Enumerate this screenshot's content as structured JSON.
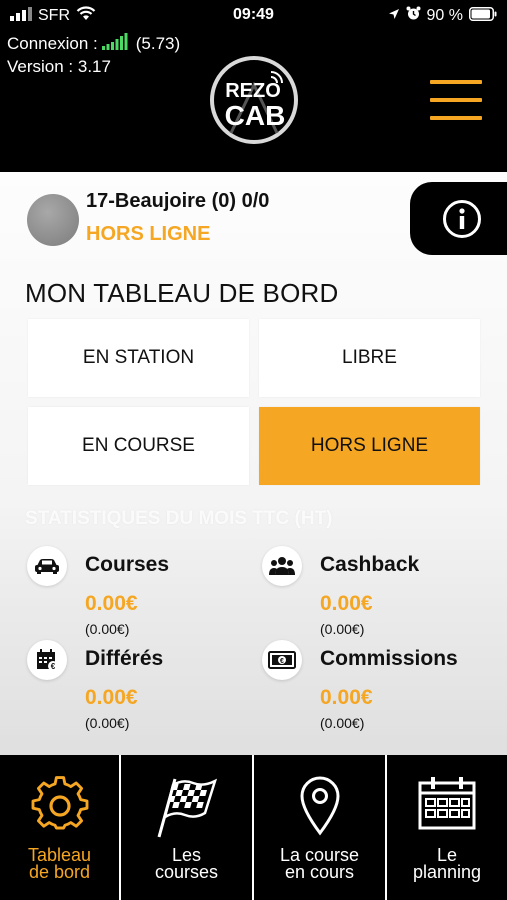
{
  "status_bar": {
    "carrier": "SFR",
    "time": "09:49",
    "battery": "90 %"
  },
  "connection": {
    "label": "Connexion :",
    "speed": "(5.73)",
    "version": "Version : 3.17"
  },
  "logo": {
    "line1": "REZO",
    "line2": "CAB"
  },
  "station": {
    "name": "17-Beaujoire (0) 0/0",
    "status": "HORS LIGNE"
  },
  "dashboard": {
    "title": "MON TABLEAU DE BORD",
    "buttons": [
      {
        "label": "EN STATION",
        "active": false
      },
      {
        "label": "LIBRE",
        "active": false
      },
      {
        "label": "EN COURSE",
        "active": false
      },
      {
        "label": "HORS LIGNE",
        "active": true
      }
    ]
  },
  "stats": {
    "title": "STATISTIQUES DU MOIS TTC (HT)",
    "items": [
      {
        "label": "Courses",
        "value": "0.00€",
        "sub": "(0.00€)",
        "icon": "car-icon"
      },
      {
        "label": "Cashback",
        "value": "0.00€",
        "sub": "(0.00€)",
        "icon": "people-icon"
      },
      {
        "label": "Différés",
        "value": "0.00€",
        "sub": "(0.00€)",
        "icon": "calendar-euro-icon"
      },
      {
        "label": "Commissions",
        "value": "0.00€",
        "sub": "(0.00€)",
        "icon": "banknote-icon"
      }
    ]
  },
  "nav": {
    "items": [
      {
        "label_line1": "Tableau",
        "label_line2": "de bord",
        "icon": "gear-icon",
        "active": true
      },
      {
        "label_line1": "Les",
        "label_line2": "courses",
        "icon": "checkered-flag-icon",
        "active": false
      },
      {
        "label_line1": "La course",
        "label_line2": "en cours",
        "icon": "map-pin-icon",
        "active": false
      },
      {
        "label_line1": "Le",
        "label_line2": "planning",
        "icon": "calendar-icon",
        "active": false
      }
    ]
  },
  "colors": {
    "accent": "#f5a623",
    "header_bg": "#000000",
    "signal_green": "#4cd964"
  }
}
